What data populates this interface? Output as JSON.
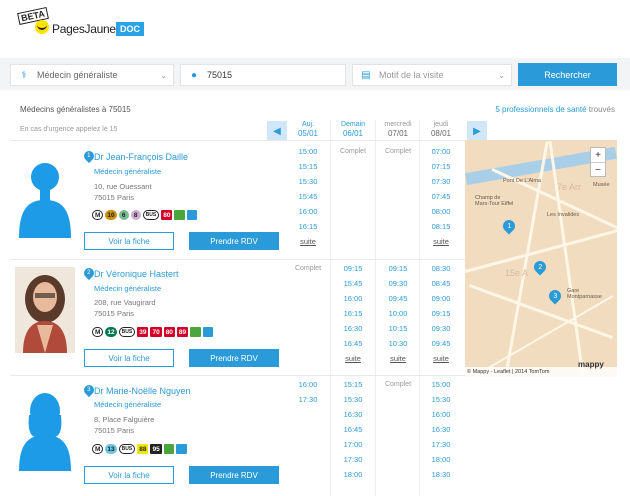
{
  "header": {
    "beta": "BETA",
    "brand": "PagesJaunes",
    "brand_suffix": "DOC"
  },
  "search": {
    "specialty_value": "Médecin généraliste",
    "location_value": "75015",
    "reason_placeholder": "Motif de la visite",
    "button": "Rechercher"
  },
  "results": {
    "title": "Médecins généralistes à 75015",
    "count": "5 professionnels de santé",
    "count_suffix": "trouvés",
    "urgence": "En cas d'urgence appelez le 15"
  },
  "days": [
    {
      "label": "Auj.",
      "date": "05/01"
    },
    {
      "label": "Demain",
      "date": "06/01"
    },
    {
      "label": "mercredi",
      "date": "07/01"
    },
    {
      "label": "jeudi",
      "date": "08/01"
    }
  ],
  "doctors": [
    {
      "pin": "1",
      "name": "Dr Jean-François Daille",
      "specialty": "Médecin généraliste",
      "address1": "10, rue Ouessant",
      "address2": "75015 Paris",
      "transit": [
        "M",
        "10",
        "6",
        "8",
        "BUS",
        "80",
        "▬",
        "▬"
      ],
      "fiche": "Voir la fiche",
      "rdv": "Prendre RDV",
      "slots": [
        [
          "15:00",
          "15:15",
          "15:30",
          "15:45",
          "16:00",
          "16:15",
          "suite"
        ],
        [
          "Complet"
        ],
        [
          "Complet"
        ],
        [
          "07:00",
          "07:15",
          "07:30",
          "07:45",
          "08:00",
          "08:15",
          "suite"
        ]
      ]
    },
    {
      "pin": "2",
      "name": "Dr Véronique Hastert",
      "specialty": "Médecin généraliste",
      "address1": "208, rue Vaugirard",
      "address2": "75015 Paris",
      "transit": [
        "M",
        "12",
        "BUS",
        "39",
        "70",
        "80",
        "89",
        "▬",
        "▬"
      ],
      "fiche": "Voir la fiche",
      "rdv": "Prendre RDV",
      "slots": [
        [
          "Complet"
        ],
        [
          "09:15",
          "15:45",
          "16:00",
          "16:15",
          "16:30",
          "16:45",
          "suite"
        ],
        [
          "09:15",
          "09:30",
          "09:45",
          "10:00",
          "10:15",
          "10:30",
          "suite"
        ],
        [
          "08:30",
          "08:45",
          "09:00",
          "09:15",
          "09:30",
          "09:45",
          "suite"
        ]
      ]
    },
    {
      "pin": "3",
      "name": "Dr Marie-Noëlle Nguyen",
      "specialty": "Médecin généraliste",
      "address1": "8, Place Falguière",
      "address2": "75015 Paris",
      "transit": [
        "M",
        "13",
        "BUS",
        "88",
        "95",
        "▬",
        "▬"
      ],
      "fiche": "Voir la fiche",
      "rdv": "Prendre RDV",
      "slots": [
        [
          "16:00",
          "17:30"
        ],
        [
          "15:15",
          "15:30",
          "16:30",
          "16:45",
          "17:00",
          "17:30",
          "18:00"
        ],
        [
          "Complet"
        ],
        [
          "15:00",
          "15:30",
          "16:00",
          "16:30",
          "17:30",
          "18:00",
          "18:30"
        ]
      ]
    }
  ],
  "map": {
    "labels": [
      "Pont De L'Alma",
      "Champ de Mars-Tour Eiffel",
      "Les Invalides",
      "Gare Montparnasse",
      "Musée"
    ],
    "big": [
      "7e Arr",
      "15e A"
    ],
    "attribution": "© Mappy - Leaflet | 2014 TomTom",
    "logo": "mappy",
    "zoom_in": "+",
    "zoom_out": "−"
  },
  "colors": {
    "accent": "#2a9ad8",
    "brand_yellow": "#fde300"
  }
}
